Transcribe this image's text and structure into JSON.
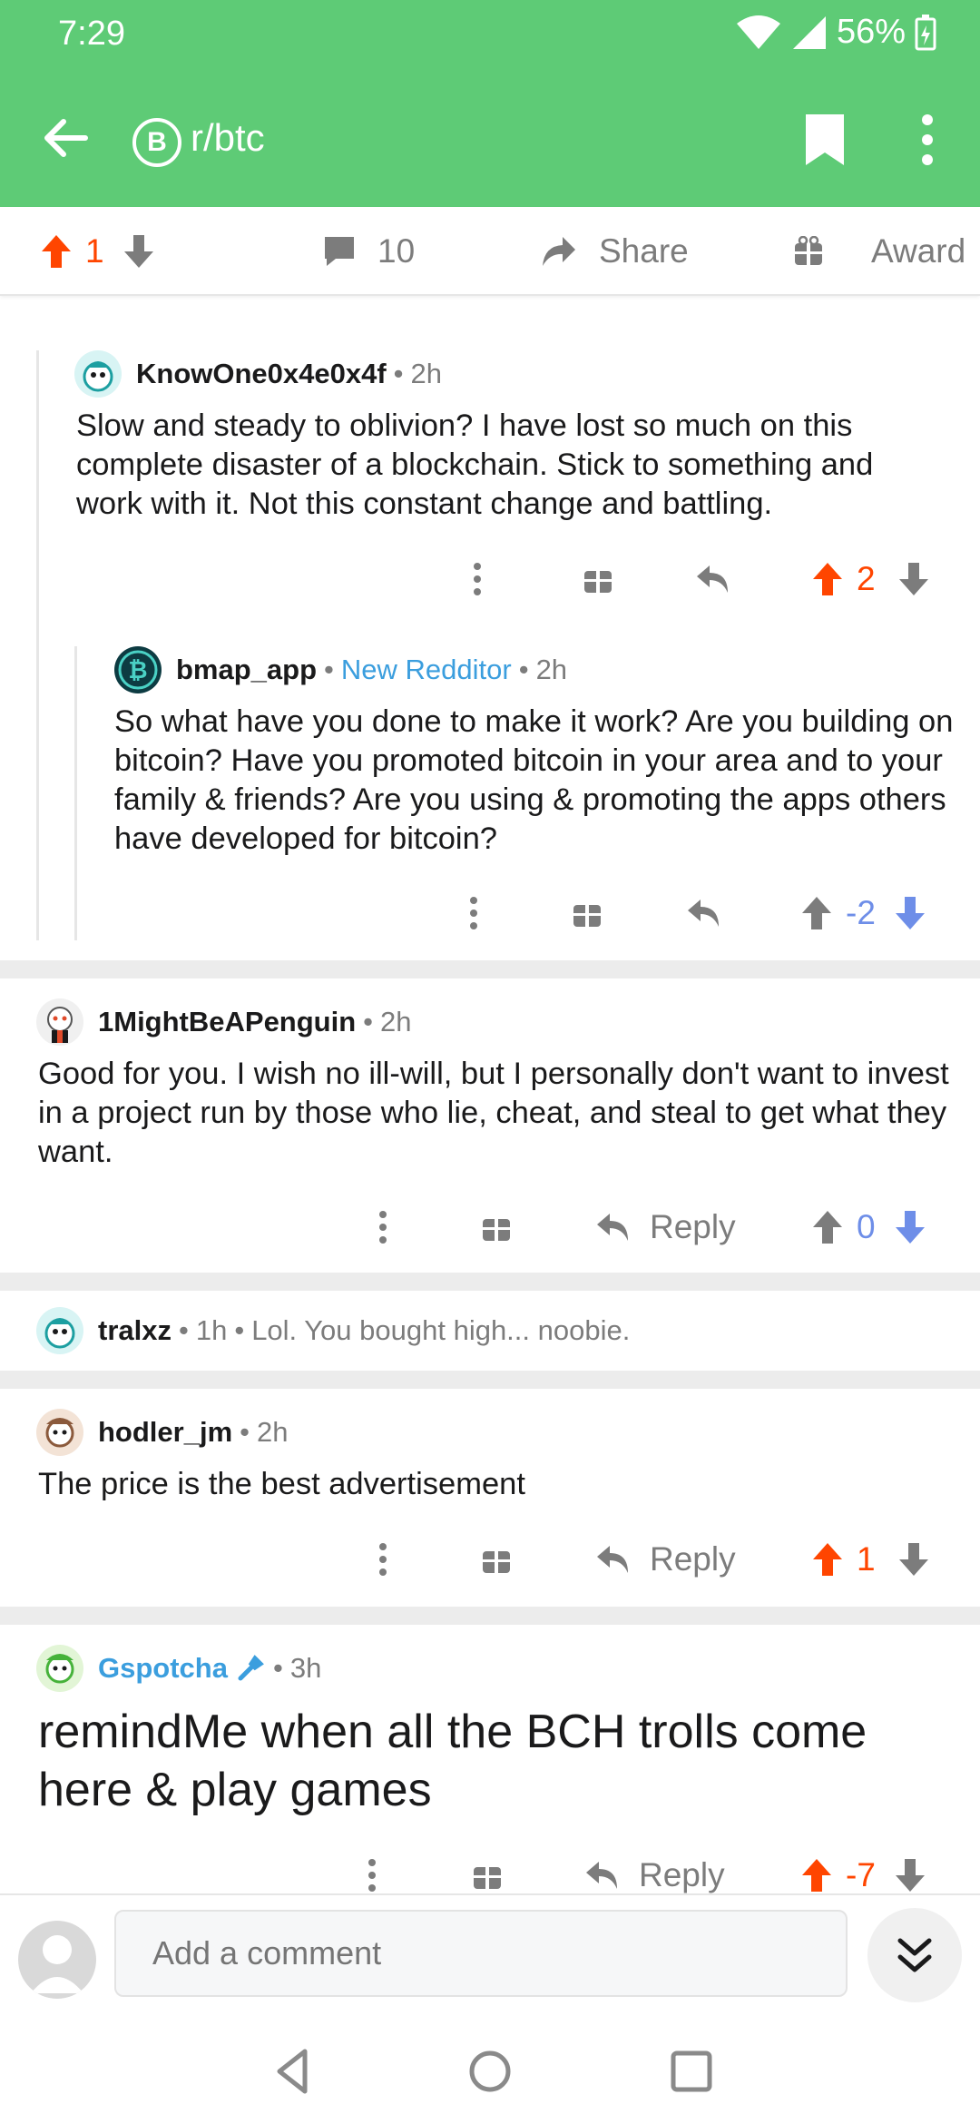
{
  "status_bar": {
    "time": "7:29",
    "battery": "56%"
  },
  "header": {
    "subreddit": "r/btc",
    "sub_icon_glyph": "B",
    "accent_color": "#5ecb76"
  },
  "post_bar": {
    "score": "1",
    "comments": "10",
    "share_label": "Share",
    "award_label": "Award"
  },
  "comments": [
    {
      "author": "KnowOne0x4e0x4f",
      "age": "2h",
      "body": "Slow and steady to oblivion? I have lost so much on this complete disaster of a blockchain. Stick to something and work with it. Not this constant change and battling.",
      "score": "2"
    },
    {
      "author": "bmap_app",
      "tag": "New Redditor",
      "age": "2h",
      "body": "So what have you done to make it work? Are you building on bitcoin? Have you promoted bitcoin in your area and to your family & friends? Are you using & promoting the apps others have developed for bitcoin?",
      "score": "-2"
    },
    {
      "author": "1MightBeAPenguin",
      "age": "2h",
      "body": "Good for you. I wish no ill-will, but I personally don't want to invest in a project run by those who lie, cheat, and steal to get what they want.",
      "reply_label": "Reply",
      "score": "0"
    },
    {
      "author": "tralxz",
      "age": "1h",
      "preview": "Lol. You bought high... noobie."
    },
    {
      "author": "hodler_jm",
      "age": "2h",
      "body": "The price is the best advertisement",
      "reply_label": "Reply",
      "score": "1"
    },
    {
      "author": "Gspotcha",
      "age": "3h",
      "body": "remindMe when all the BCH trolls come here & play games",
      "reply_label": "Reply",
      "score": "-7"
    }
  ],
  "comment_bar": {
    "placeholder": "Add a comment"
  },
  "colors": {
    "upvote": "#ff4500",
    "downvote": "#6e8ee8",
    "meta": "#7c7c7c",
    "link": "#3b9ede"
  }
}
